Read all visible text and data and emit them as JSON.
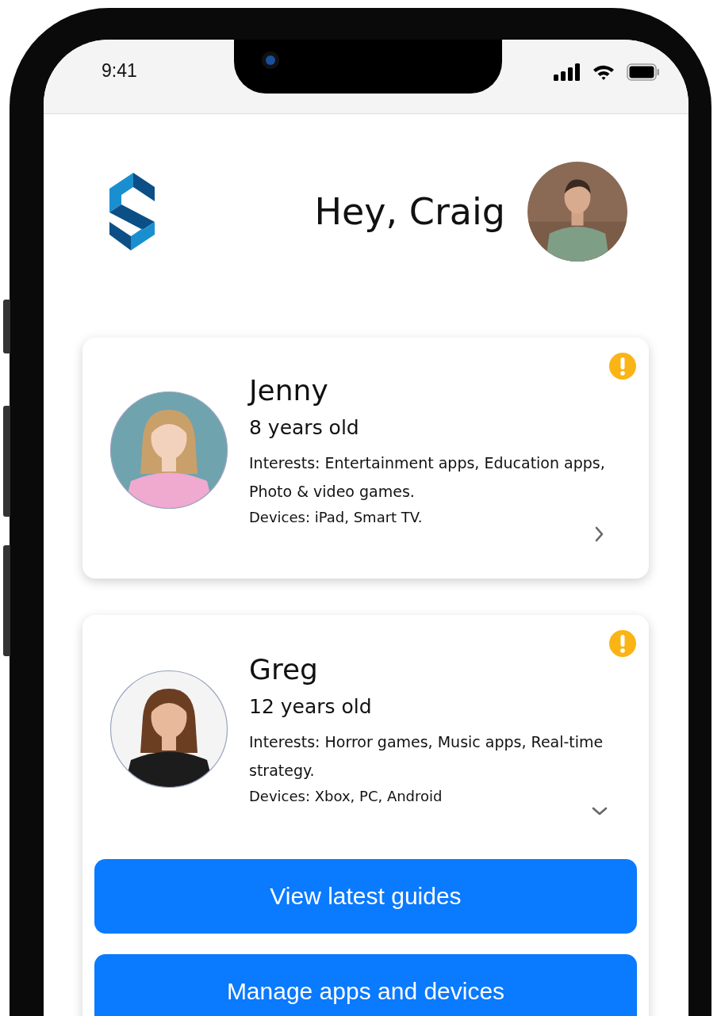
{
  "status_bar": {
    "time": "9:41"
  },
  "header": {
    "greeting": "Hey, Craig"
  },
  "profiles": [
    {
      "name": "Jenny",
      "age": "8 years old",
      "interests": "Interests: Entertainment apps, Education apps, Photo & video games.",
      "devices": "Devices: iPad, Smart TV.",
      "alert": true,
      "expanded": false
    },
    {
      "name": "Greg",
      "age": "12 years old",
      "interests": "Interests: Horror games, Music apps, Real-time strategy.",
      "devices": "Devices: Xbox, PC, Android",
      "alert": true,
      "expanded": true,
      "actions": [
        "View latest guides",
        "Manage apps and devices"
      ]
    }
  ]
}
